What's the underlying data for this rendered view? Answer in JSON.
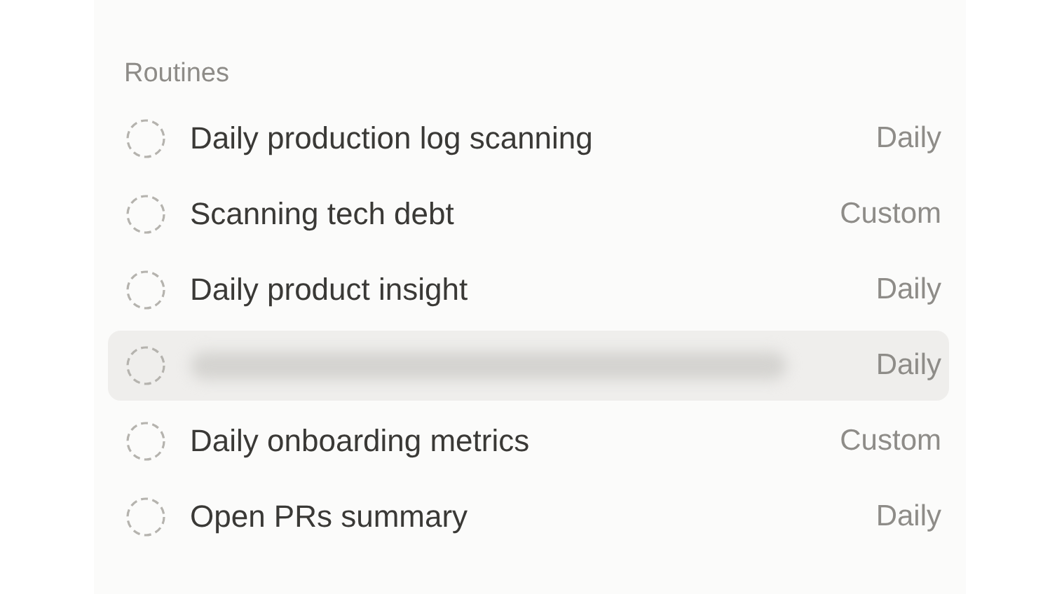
{
  "section": {
    "heading": "Routines",
    "routines": [
      {
        "kind": "named",
        "title": "Daily production log scanning",
        "schedule": "Daily",
        "selected": false
      },
      {
        "kind": "named",
        "title": "Scanning tech debt",
        "schedule": "Custom",
        "selected": false
      },
      {
        "kind": "named",
        "title": "Daily product insight",
        "schedule": "Daily",
        "selected": false
      },
      {
        "kind": "redacted",
        "schedule": "Daily",
        "selected": true
      },
      {
        "kind": "named",
        "title": "Daily onboarding metrics",
        "schedule": "Custom",
        "selected": false
      },
      {
        "kind": "named",
        "title": "Open PRs summary",
        "schedule": "Daily",
        "selected": false
      }
    ]
  }
}
